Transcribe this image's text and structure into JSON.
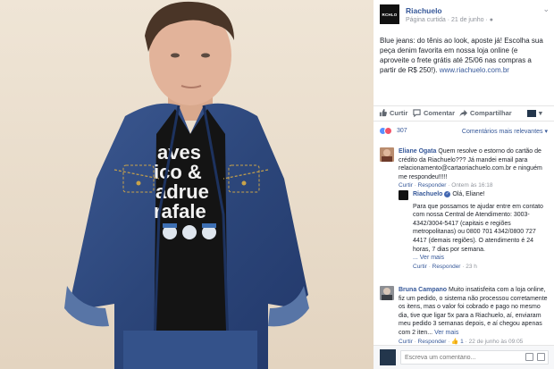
{
  "photo": {
    "shirt_words": [
      "aves",
      "ico &",
      "adrue",
      "rafale"
    ]
  },
  "post": {
    "page_name": "Riachuelo",
    "logo_text": "RCHLO",
    "meta": "Página curtida · 21 de junho · ",
    "text": "Blue jeans: do tênis ao look, aposte já! Escolha sua peça denim favorita em nossa loja online (e aproveite o frete grátis até 25/06 nas compras a partir de R$ 250!). ",
    "link": "www.riachuelo.com.br"
  },
  "actions": {
    "like": "Curtir",
    "comment": "Comentar",
    "share": "Compartilhar"
  },
  "reactions": {
    "count": "307",
    "sort": "Comentários mais relevantes ▾"
  },
  "comments": [
    {
      "author": "Eliane Ogata",
      "text": "Quem resolve o estorno do cartão de crédito da Riachuelo??? Já mandei email para relacionamento@cartaoriachuelo.com.br e ninguém me respondeu!!!!!",
      "like": "Curtir",
      "reply": "Responder",
      "time": "Ontem às 16:18"
    },
    {
      "author": "Riachuelo",
      "text": "Olá, Eliane!",
      "text2": "Para que possamos te ajudar entre em contato com nossa Central de Atendimento: 3003-4342/3004-5417 (capitais e regiões metropolitanas) ou 0800 701 4342/0800 727 4417 (demais regiões). O atendimento é 24 horas, 7 dias por semana.",
      "more": "... Ver mais",
      "like": "Curtir",
      "reply": "Responder",
      "time": "23 h"
    },
    {
      "author": "Bruna Campano",
      "text": "Muito insatisfeita com a loja online, fiz um pedido, o sistema não processou corretamente os itens, mas o valor foi cobrado e pago no mesmo dia, tive que ligar 5x para a Riachuelo, aí, enviaram meu pedido 3 semanas depois, e aí chegou apenas com 2 iten...",
      "more": "Ver mais",
      "like": "Curtir",
      "reply": "Responder",
      "likes": "1",
      "time": "22 de junho às 09:05"
    }
  ],
  "write": {
    "placeholder": "Escreva um comentário..."
  },
  "colors": {
    "link": "#365899",
    "muted": "#90949c",
    "photo_bg": "#e9ddcd",
    "denim": "#2f4a7d"
  }
}
